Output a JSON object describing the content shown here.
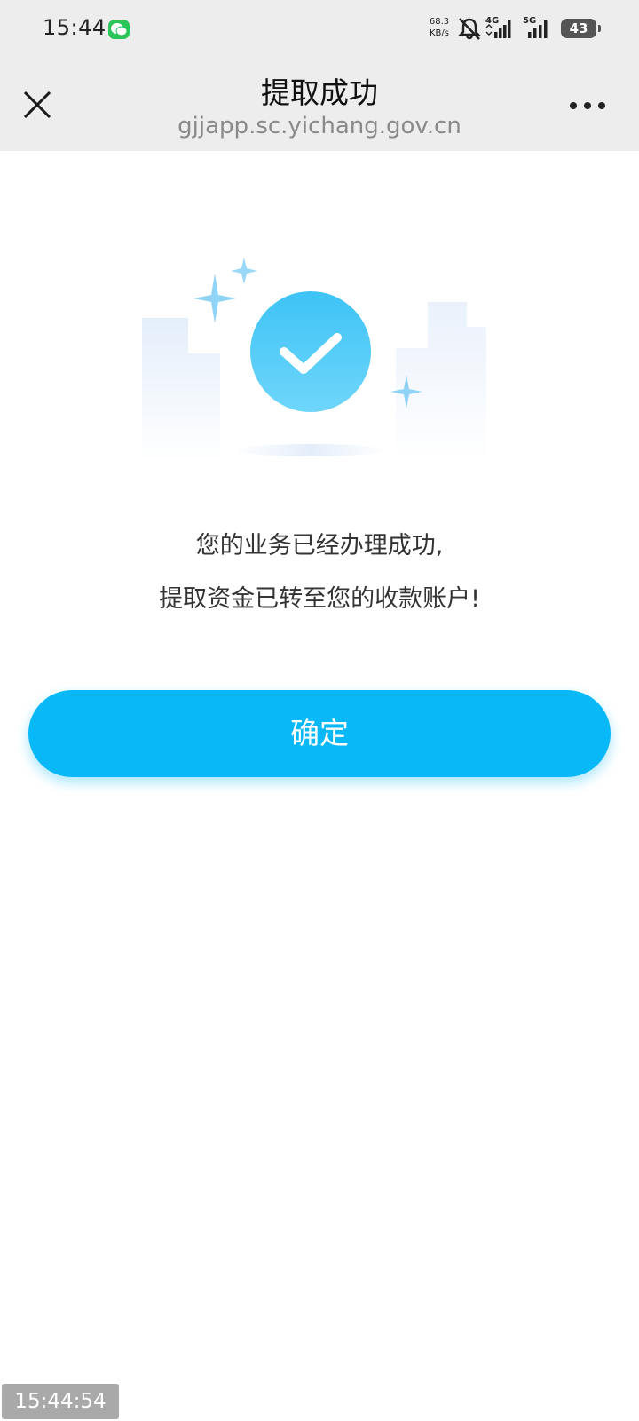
{
  "status_bar": {
    "time": "15:44",
    "net_speed_value": "68.3",
    "net_speed_unit": "KB/s",
    "signal_1_label": "4G",
    "signal_2_label": "5G",
    "battery": "43"
  },
  "header": {
    "title": "提取成功",
    "url": "gjjapp.sc.yichang.gov.cn"
  },
  "main": {
    "message_line_1": "您的业务已经办理成功,",
    "message_line_2": "提取资金已转至您的收款账户!",
    "confirm_label": "确定"
  },
  "overlay": {
    "timestamp": "15:44:54"
  },
  "colors": {
    "accent": "#08b8f7",
    "status_bar_bg": "#ededed",
    "check_circle": "#4cc8f6"
  }
}
